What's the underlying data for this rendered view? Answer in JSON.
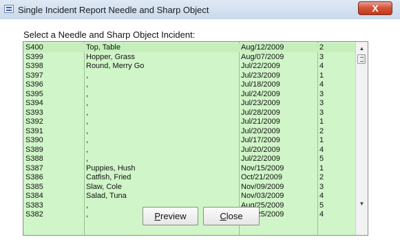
{
  "window": {
    "title": "Single Incident Report Needle and Sharp Object",
    "close_glyph": "X"
  },
  "prompt": "Select a Needle and Sharp Object Incident:",
  "rows": [
    {
      "id": "S400",
      "name": "Top, Table",
      "date": "Aug/12/2009",
      "num": "2"
    },
    {
      "id": "S399",
      "name": "Hopper, Grass",
      "date": "Aug/07/2009",
      "num": "3"
    },
    {
      "id": "S398",
      "name": "Round, Merry Go",
      "date": "Jul/22/2009",
      "num": "4"
    },
    {
      "id": "S397",
      "name": ",",
      "date": "Jul/23/2009",
      "num": "1"
    },
    {
      "id": "S396",
      "name": ",",
      "date": "Jul/18/2009",
      "num": "4"
    },
    {
      "id": "S395",
      "name": ",",
      "date": "Jul/24/2009",
      "num": "3"
    },
    {
      "id": "S394",
      "name": ",",
      "date": "Jul/23/2009",
      "num": "3"
    },
    {
      "id": "S393",
      "name": ",",
      "date": "Jul/28/2009",
      "num": "3"
    },
    {
      "id": "S392",
      "name": ",",
      "date": "Jul/21/2009",
      "num": "1"
    },
    {
      "id": "S391",
      "name": ",",
      "date": "Jul/20/2009",
      "num": "2"
    },
    {
      "id": "S390",
      "name": ",",
      "date": "Jul/17/2009",
      "num": "1"
    },
    {
      "id": "S389",
      "name": ",",
      "date": "Jul/20/2009",
      "num": "4"
    },
    {
      "id": "S388",
      "name": ",",
      "date": "Jul/22/2009",
      "num": "5"
    },
    {
      "id": "S387",
      "name": "Puppies, Hush",
      "date": "Nov/15/2009",
      "num": "1"
    },
    {
      "id": "S386",
      "name": "Catfish, Fried",
      "date": "Oct/21/2009",
      "num": "2"
    },
    {
      "id": "S385",
      "name": "Slaw, Cole",
      "date": "Nov/09/2009",
      "num": "3"
    },
    {
      "id": "S384",
      "name": "Salad, Tuna",
      "date": "Nov/03/2009",
      "num": "4"
    },
    {
      "id": "S383",
      "name": ",",
      "date": "Aug/25/2009",
      "num": "5"
    },
    {
      "id": "S382",
      "name": ",",
      "date": "Aug/25/2009",
      "num": "4"
    }
  ],
  "buttons": {
    "preview_prefix": "",
    "preview_accel": "P",
    "preview_rest": "review",
    "close_prefix": "",
    "close_accel": "C",
    "close_rest": "lose"
  },
  "scroll": {
    "up_glyph": "▲",
    "down_glyph": "▼"
  },
  "colors": {
    "list_background": "#d0f5c8",
    "title_close": "#c2381e"
  }
}
